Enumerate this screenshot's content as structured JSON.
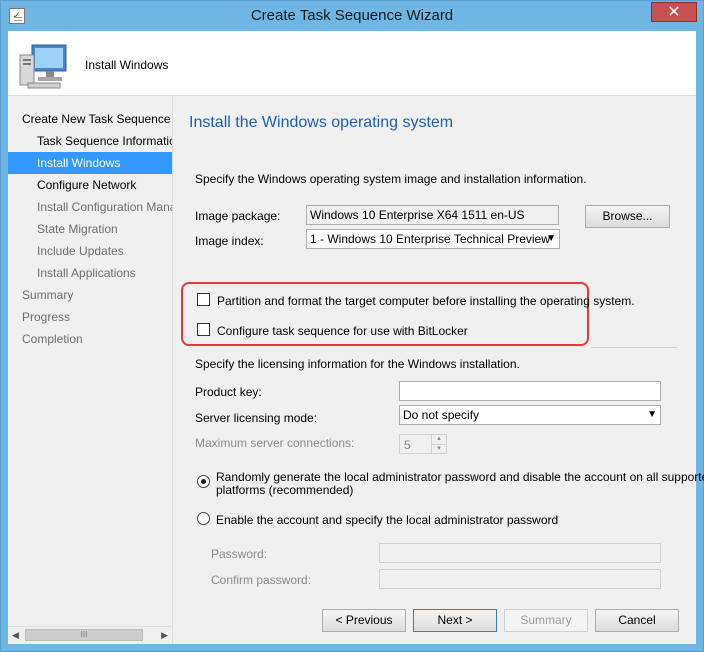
{
  "window": {
    "title": "Create Task Sequence Wizard",
    "close_glyph": "✕"
  },
  "header": {
    "title": "Install Windows",
    "icon": "computer-monitor-icon"
  },
  "nav": {
    "items": [
      {
        "label": "Create New Task Sequence",
        "state": "normal",
        "level": "top"
      },
      {
        "label": "Task Sequence Information",
        "state": "normal",
        "level": "sub"
      },
      {
        "label": "Install Windows",
        "state": "active",
        "level": "sub"
      },
      {
        "label": "Configure Network",
        "state": "normal",
        "level": "sub"
      },
      {
        "label": "Install Configuration Manager",
        "state": "disabled",
        "level": "sub"
      },
      {
        "label": "State Migration",
        "state": "disabled",
        "level": "sub"
      },
      {
        "label": "Include Updates",
        "state": "disabled",
        "level": "sub"
      },
      {
        "label": "Install Applications",
        "state": "disabled",
        "level": "sub"
      },
      {
        "label": "Summary",
        "state": "disabled",
        "level": "top"
      },
      {
        "label": "Progress",
        "state": "disabled",
        "level": "top"
      },
      {
        "label": "Completion",
        "state": "disabled",
        "level": "top"
      }
    ],
    "scroll_left": "◀",
    "scroll_right": "▶",
    "scroll_grip": "III"
  },
  "page": {
    "title": "Install the Windows operating system",
    "description": "Specify the Windows operating system image and installation information.",
    "image_package_label": "Image package:",
    "image_package_value": "Windows 10 Enterprise X64 1511 en-US",
    "browse_label": "Browse...",
    "image_index_label": "Image index:",
    "image_index_value": "1 - Windows 10 Enterprise Technical Preview",
    "partition_label": "Partition and format the target computer before installing the operating system.",
    "bitlocker_label": "Configure task sequence for use with BitLocker",
    "licensing_description": "Specify the licensing information for the Windows installation.",
    "product_key_label": "Product key:",
    "product_key_value": "",
    "server_mode_label": "Server licensing mode:",
    "server_mode_value": "Do not specify",
    "max_connections_label": "Maximum server connections:",
    "max_connections_value": "5",
    "random_password_label_1": "Randomly generate the local administrator password and disable the account on all supported",
    "random_password_label_2": "platforms (recommended)",
    "enable_account_label": "Enable the account and specify the local administrator password",
    "password_label": "Password:",
    "confirm_password_label": "Confirm password:"
  },
  "buttons": {
    "previous": "< Previous",
    "next": "Next >",
    "summary": "Summary",
    "cancel": "Cancel"
  },
  "colors": {
    "accent": "#3399ff",
    "title_blue": "#1f5fad",
    "highlight_red": "#e43a3a"
  }
}
